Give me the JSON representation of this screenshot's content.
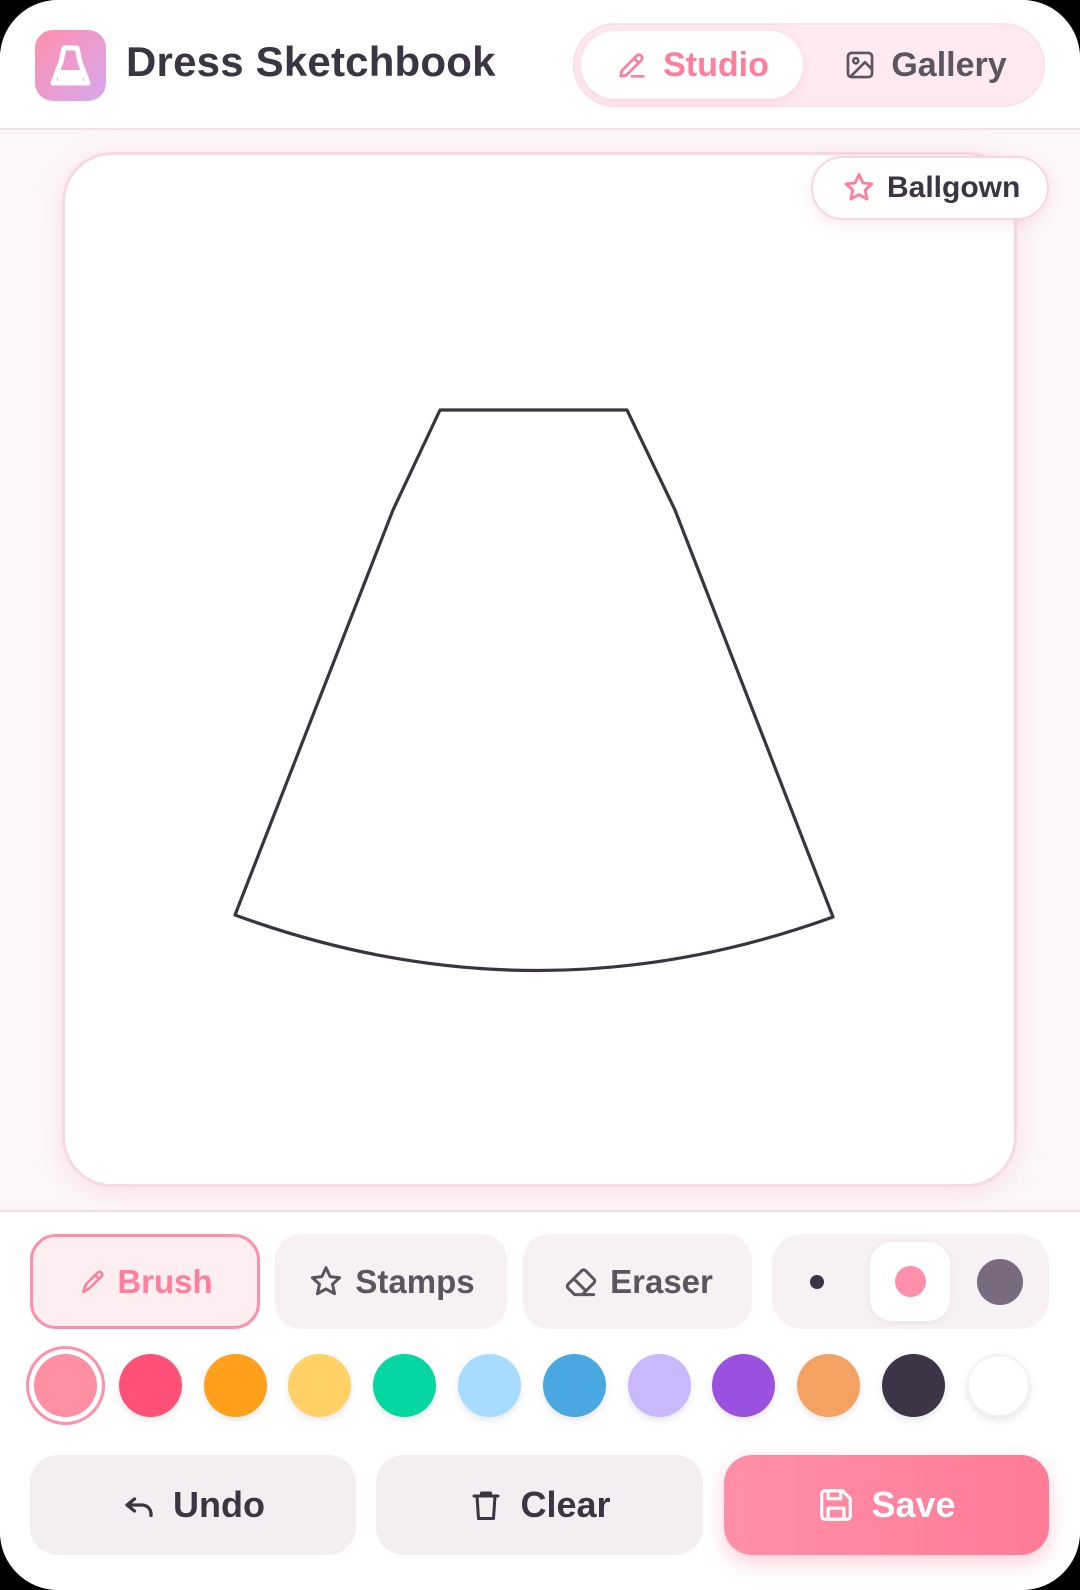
{
  "app": {
    "title": "Dress Sketchbook",
    "logo_icon": "dress-icon"
  },
  "tabs": [
    {
      "label": "Studio",
      "icon": "pencil-icon",
      "active": true
    },
    {
      "label": "Gallery",
      "icon": "image-icon",
      "active": false
    }
  ],
  "canvas": {
    "style_label": "Ballgown",
    "style_icon": "star-icon",
    "template": "ballgown-skirt-outline"
  },
  "tools": [
    {
      "label": "Brush",
      "icon": "brush-icon",
      "active": true
    },
    {
      "label": "Stamps",
      "icon": "star-icon",
      "active": false
    },
    {
      "label": "Eraser",
      "icon": "eraser-icon",
      "active": false
    }
  ],
  "brush_sizes": {
    "options": [
      "small",
      "medium",
      "large"
    ],
    "selected": "medium"
  },
  "palette": {
    "colors": [
      "#ff8fa3",
      "#ff5177",
      "#ff9f1c",
      "#ffd166",
      "#06d6a0",
      "#a8dcff",
      "#4aa8e0",
      "#c9b8fb",
      "#9b51e0",
      "#f4a261",
      "#3d3545",
      "#ffffff"
    ],
    "selected": "#ff8fa3"
  },
  "actions": {
    "undo_label": "Undo",
    "clear_label": "Clear",
    "save_label": "Save"
  },
  "colors": {
    "accent": "#ff7e9b",
    "text": "#3b3442",
    "muted": "#5b5560"
  }
}
